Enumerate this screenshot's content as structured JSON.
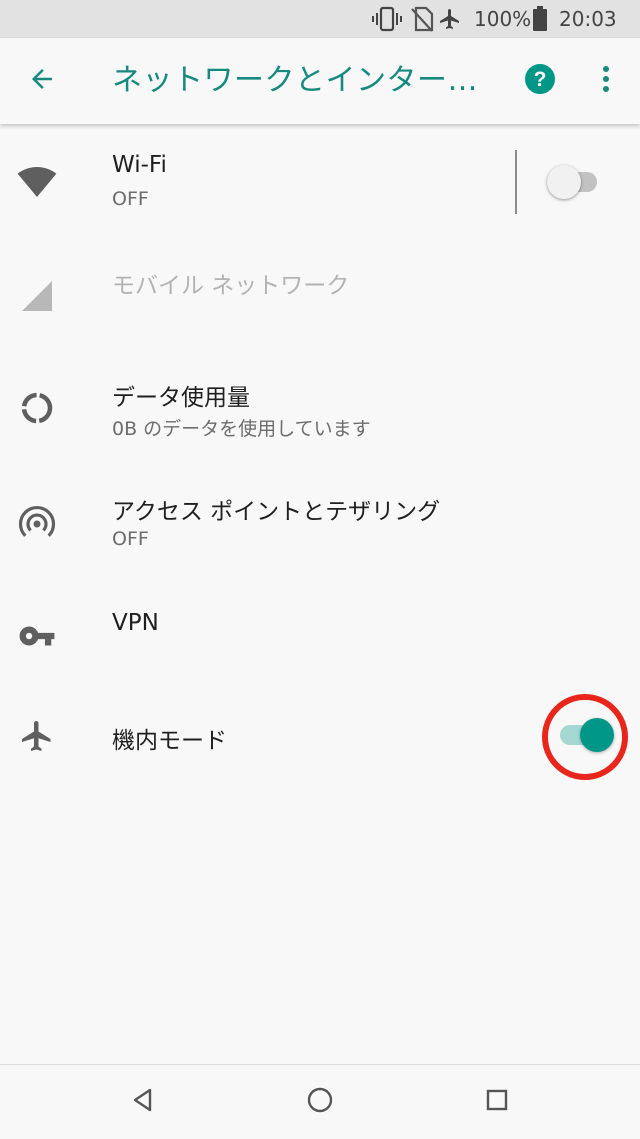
{
  "status_bar": {
    "icons": [
      "vibrate-icon",
      "no-sim-icon",
      "airplane-icon",
      "battery-icon"
    ],
    "battery": "100%",
    "time": "20:03"
  },
  "toolbar": {
    "title": "ネットワークとインター…",
    "back_icon": "arrow-back-icon",
    "help_icon": "help-icon",
    "more_icon": "more-vert-icon"
  },
  "items": [
    {
      "title": "Wi-Fi",
      "summary": "OFF",
      "icon": "wifi-icon",
      "toggle": "off"
    },
    {
      "title": "モバイル ネットワーク",
      "icon": "signal-icon",
      "enabled": false
    },
    {
      "title": "データ使用量",
      "summary": "0B のデータを使用しています",
      "icon": "data-usage-icon"
    },
    {
      "title": "アクセス ポイントとテザリング",
      "summary": "OFF",
      "icon": "hotspot-icon"
    },
    {
      "title": "VPN",
      "icon": "vpn-key-icon"
    },
    {
      "title": "機内モード",
      "icon": "airplane-icon",
      "toggle": "on"
    }
  ],
  "nav_bar": [
    "back-triangle-icon",
    "home-circle-icon",
    "recents-square-icon"
  ],
  "colors": {
    "accent": "#009688",
    "title": "#168a7e",
    "highlight": "#e8261b",
    "status_bar_bg": "#e2e2e2",
    "background": "#f8f8f8"
  }
}
